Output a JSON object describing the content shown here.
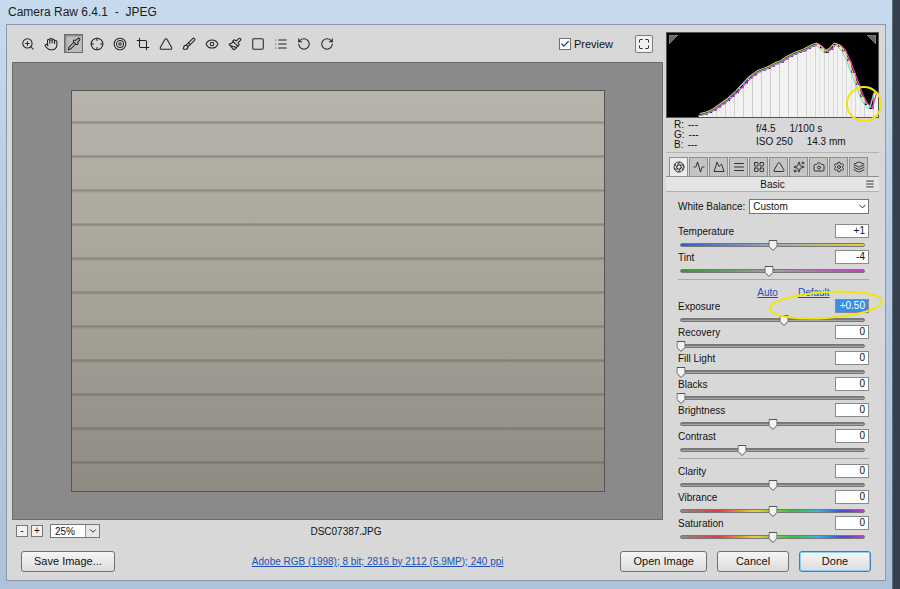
{
  "window": {
    "title": "Camera Raw 6.4.1  -  JPEG"
  },
  "toolbar": {
    "tools": [
      {
        "selected": false
      },
      {
        "selected": false
      },
      {
        "selected": true
      },
      {
        "selected": false
      },
      {
        "selected": false
      },
      {
        "selected": false
      },
      {
        "selected": false
      },
      {
        "selected": false
      },
      {
        "selected": false
      },
      {
        "selected": false
      },
      {
        "selected": false
      },
      {
        "selected": false
      },
      {
        "selected": false
      },
      {
        "selected": false
      }
    ],
    "preview": {
      "label": "Preview",
      "checked": true
    }
  },
  "preview_bar": {
    "zoom_out": "-",
    "zoom_in": "+",
    "zoom": "25%",
    "filename": "DSC07387.JPG"
  },
  "histogram": {
    "values": [
      2,
      3,
      5,
      8,
      12,
      16,
      20,
      25,
      30,
      36,
      42,
      48,
      52,
      56,
      58,
      60,
      63,
      66,
      68,
      72,
      75,
      78,
      80,
      82,
      85,
      88,
      90,
      86,
      80,
      84,
      90,
      88,
      82,
      70,
      55,
      40,
      25,
      15,
      10,
      30
    ]
  },
  "info": {
    "rgb": [
      {
        "label": "R:",
        "value": "---"
      },
      {
        "label": "G:",
        "value": "---"
      },
      {
        "label": "B:",
        "value": "---"
      }
    ],
    "exif": [
      [
        "f/4.5",
        "1/100 s"
      ],
      [
        "ISO 250",
        "14.3 mm"
      ]
    ]
  },
  "panel_tabs": [
    {
      "selected": true
    },
    {
      "selected": false
    },
    {
      "selected": false
    },
    {
      "selected": false
    },
    {
      "selected": false
    },
    {
      "selected": false
    },
    {
      "selected": false
    },
    {
      "selected": false
    },
    {
      "selected": false
    },
    {
      "selected": false
    }
  ],
  "panel": {
    "title": "Basic",
    "white_balance": {
      "label": "White Balance:",
      "value": "Custom"
    },
    "groups": [
      {
        "links": [],
        "sliders": [
          {
            "name": "Temperature",
            "reading": "+1",
            "level": 0.505,
            "kind": "temperature",
            "selected": false
          },
          {
            "name": "Tint",
            "reading": "-4",
            "level": 0.48,
            "kind": "tint",
            "selected": false
          }
        ]
      },
      {
        "links": [
          "Auto",
          "Default"
        ],
        "sliders": [
          {
            "name": "Exposure",
            "reading": "+0.50",
            "level": 0.5625,
            "kind": "plain",
            "selected": true
          },
          {
            "name": "Recovery",
            "reading": "0",
            "level": 0,
            "kind": "plain",
            "selected": false
          },
          {
            "name": "Fill Light",
            "reading": "0",
            "level": 0,
            "kind": "plain",
            "selected": false
          },
          {
            "name": "Blacks",
            "reading": "0",
            "level": 0,
            "kind": "plain",
            "selected": false
          },
          {
            "name": "Brightness",
            "reading": "0",
            "level": 0.5,
            "kind": "plain",
            "selected": false
          },
          {
            "name": "Contrast",
            "reading": "0",
            "level": 0.333,
            "kind": "plain",
            "selected": false
          }
        ]
      },
      {
        "links": [],
        "sliders": [
          {
            "name": "Clarity",
            "reading": "0",
            "level": 0.5,
            "kind": "plain",
            "selected": false
          },
          {
            "name": "Vibrance",
            "reading": "0",
            "level": 0.5,
            "kind": "saturation",
            "selected": false
          },
          {
            "name": "Saturation",
            "reading": "0",
            "level": 0.5,
            "kind": "saturation",
            "selected": false
          }
        ]
      }
    ]
  },
  "bottom_bar": {
    "save": {
      "label": "Save Image...",
      "default": false
    },
    "link": "Adobe RGB (1998); 8 bit; 2816 by 2112 (5.9MP); 240 ppi",
    "buttons": [
      {
        "label": "Open Image",
        "default": false
      },
      {
        "label": "Cancel",
        "default": false
      },
      {
        "label": "Done",
        "default": true
      }
    ]
  }
}
